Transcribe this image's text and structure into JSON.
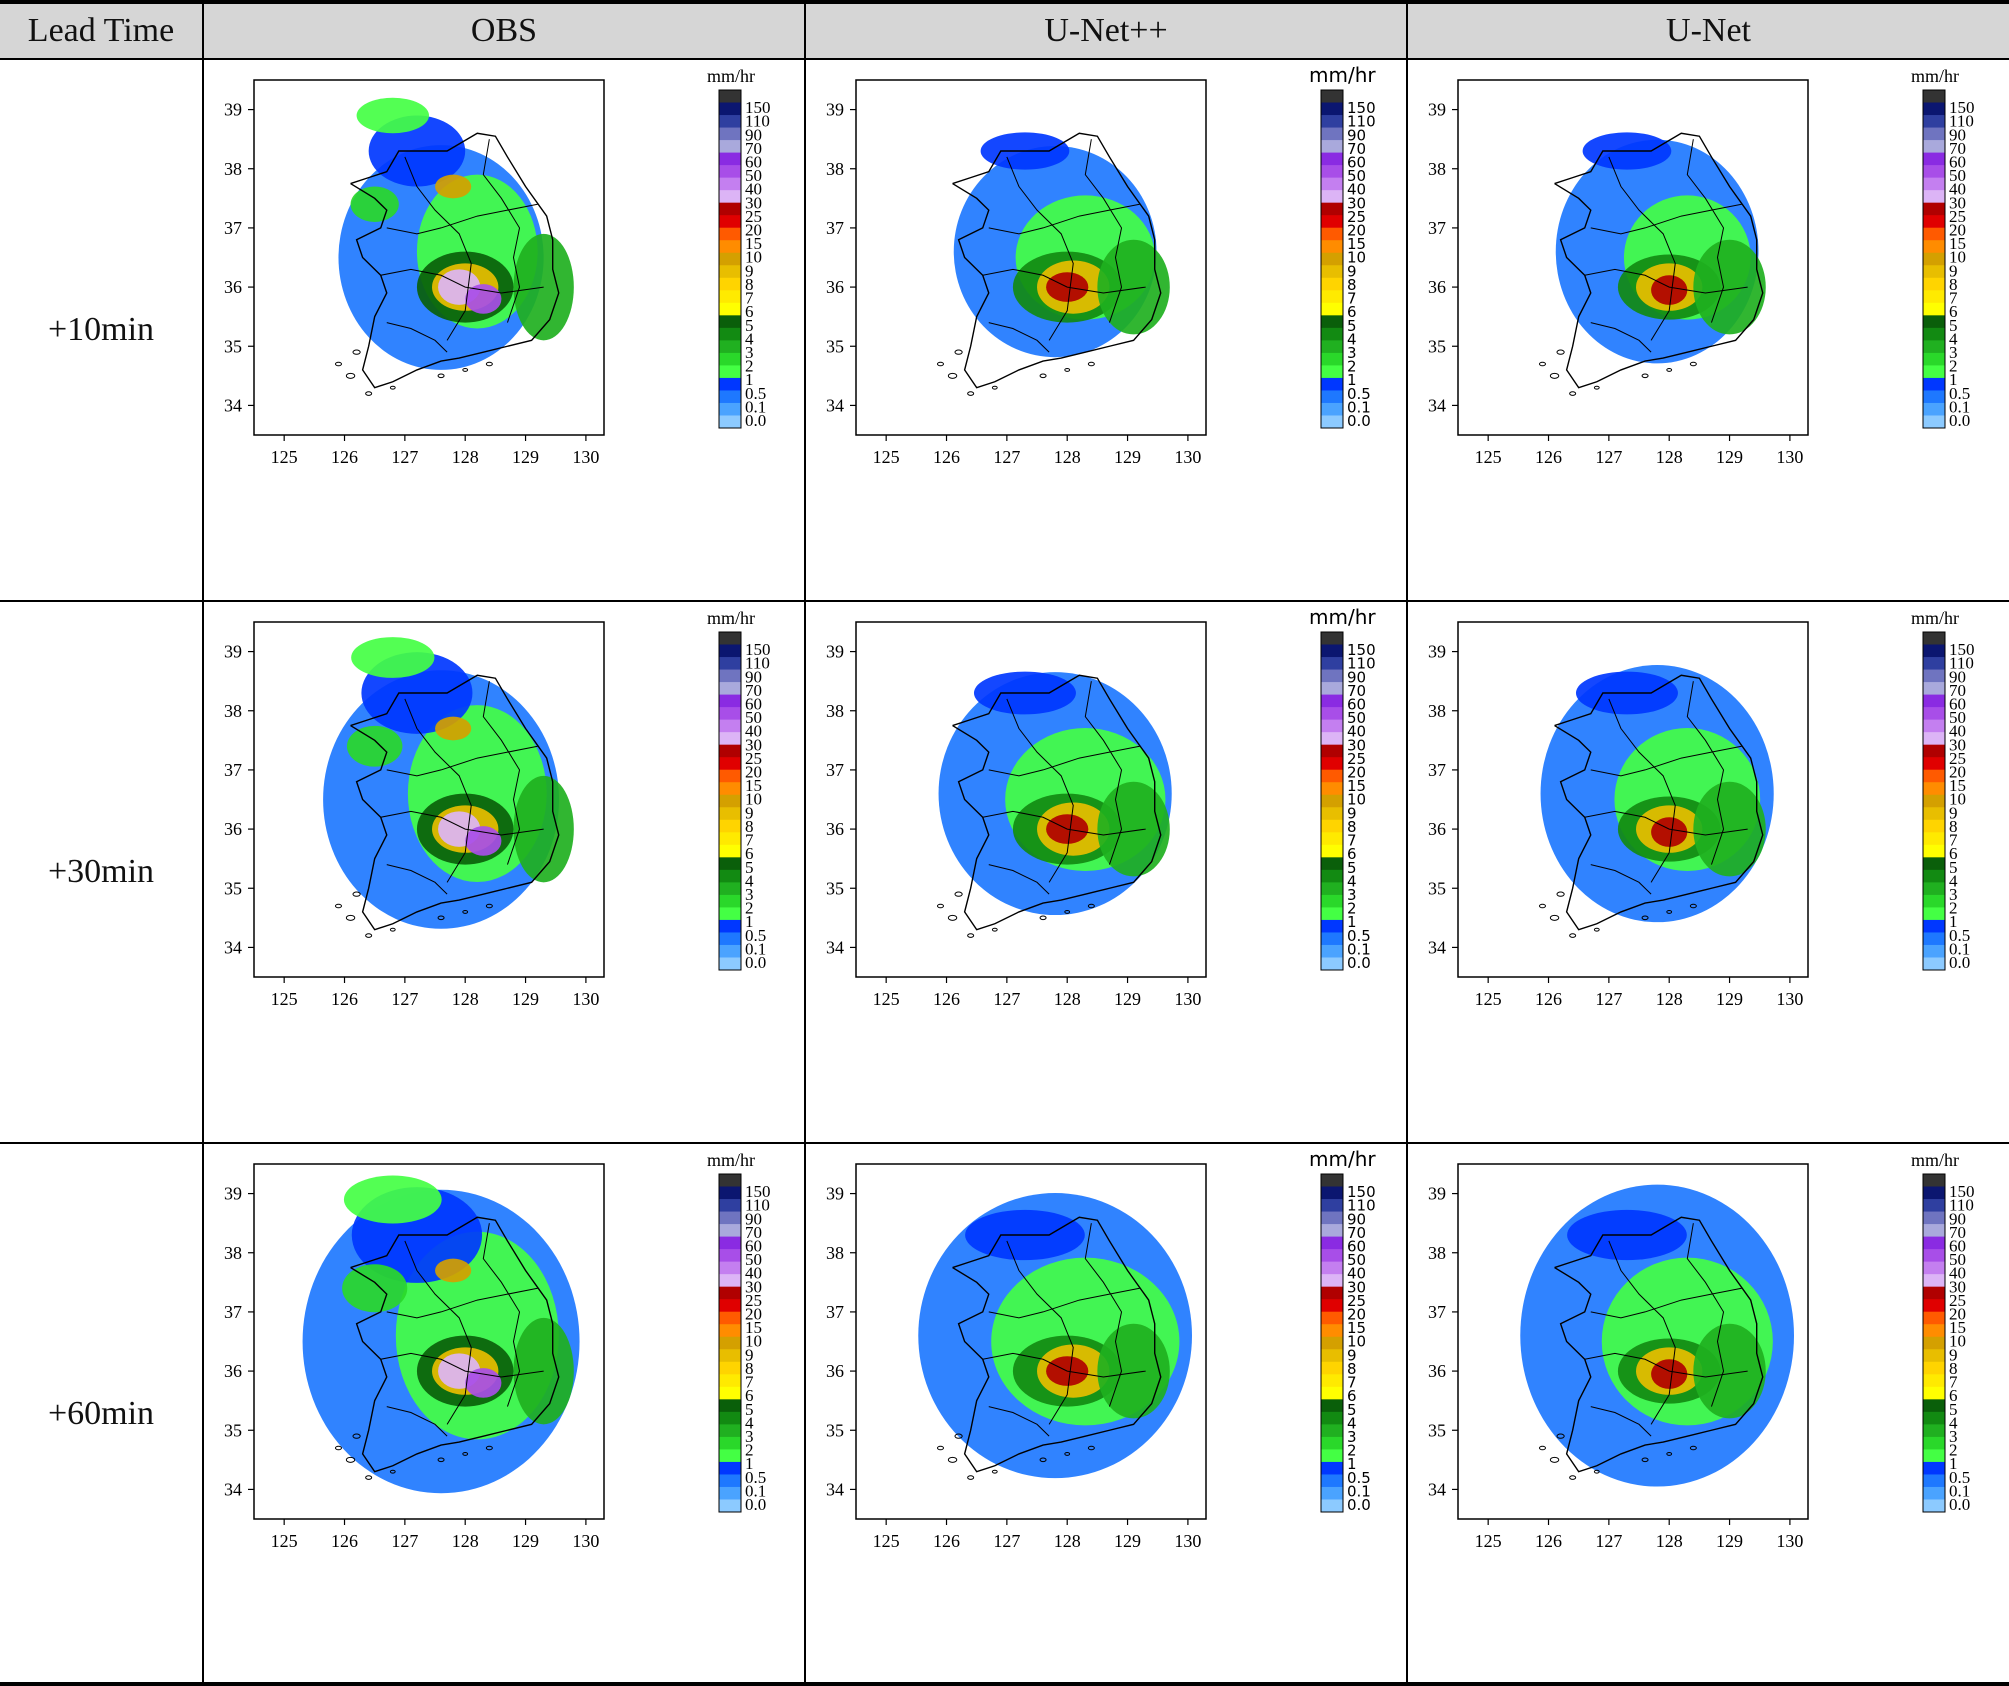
{
  "table": {
    "headers": [
      "Lead Time",
      "OBS",
      "U-Net++",
      "U-Net"
    ],
    "rows": [
      {
        "lead_time": "+10min"
      },
      {
        "lead_time": "+30min"
      },
      {
        "lead_time": "+60min"
      }
    ]
  },
  "map": {
    "x_ticks": [
      "125",
      "126",
      "127",
      "128",
      "129",
      "130"
    ],
    "y_ticks": [
      "39",
      "38",
      "37",
      "36",
      "35",
      "34"
    ],
    "colorbar_unit": "mm/hr",
    "colorbar_labels": [
      "150",
      "110",
      "90",
      "70",
      "60",
      "50",
      "40",
      "30",
      "25",
      "20",
      "15",
      "10",
      "9",
      "8",
      "7",
      "6",
      "5",
      "4",
      "3",
      "2",
      "1",
      "0.5",
      "0.1",
      "0.0"
    ],
    "colorbar_colors": [
      "#333333",
      "#0b1670",
      "#2f3fa0",
      "#6f74c0",
      "#a9a9dc",
      "#8a2be2",
      "#a84ee8",
      "#c47ff0",
      "#dcb4f6",
      "#b00000",
      "#e00000",
      "#ff5a00",
      "#ff8c00",
      "#d4a000",
      "#e8be00",
      "#ffd400",
      "#ffea00",
      "#ffff00",
      "#0a5f0a",
      "#128a12",
      "#20b020",
      "#2ad82a",
      "#44ff44",
      "#0037ff",
      "#1e78ff",
      "#4aa3ff",
      "#8ccaff"
    ]
  },
  "colors": {
    "header_bg": "#d6d6d6",
    "rule": "#000000"
  }
}
